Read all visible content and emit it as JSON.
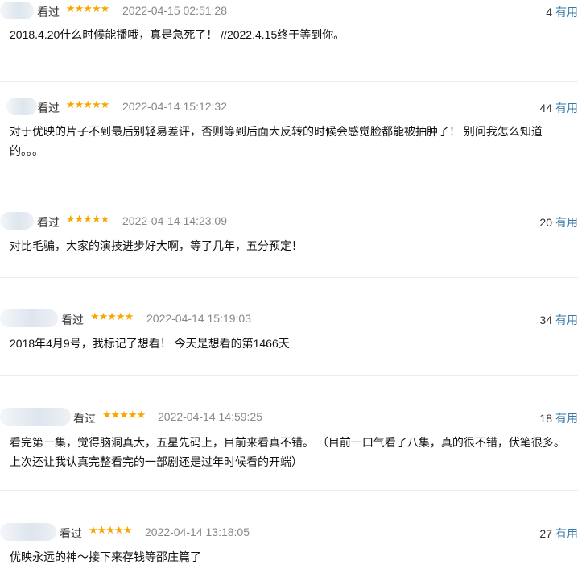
{
  "comments": [
    {
      "watched": "看过",
      "stars": "★★★★★",
      "time": "2022-04-15 02:51:28",
      "votes": "4",
      "helpful_label": "有用",
      "content": "2018.4.20什么时候能播哦，真是急死了！ //2022.4.15终于等到你。"
    },
    {
      "watched": "看过",
      "stars": "★★★★★",
      "time": "2022-04-14 15:12:32",
      "votes": "44",
      "helpful_label": "有用",
      "content": "对于优映的片子不到最后别轻易差评，否则等到后面大反转的时候会感觉脸都能被抽肿了！ 别问我怎么知道的。。。"
    },
    {
      "watched": "看过",
      "stars": "★★★★★",
      "time": "2022-04-14 14:23:09",
      "votes": "20",
      "helpful_label": "有用",
      "content": "对比毛骗，大家的演技进步好大啊，等了几年，五分预定！"
    },
    {
      "watched": "看过",
      "stars": "★★★★★",
      "time": "2022-04-14 15:19:03",
      "votes": "34",
      "helpful_label": "有用",
      "content": "2018年4月9号，我标记了想看！ 今天是想看的第1466天"
    },
    {
      "watched": "看过",
      "stars": "★★★★★",
      "time": "2022-04-14 14:59:25",
      "votes": "18",
      "helpful_label": "有用",
      "content": "看完第一集，觉得脑洞真大，五星先码上，目前来看真不错。 （目前一口气看了八集，真的很不错，伏笔很多。上次还让我认真完整看完的一部剧还是过年时候看的开端）"
    },
    {
      "watched": "看过",
      "stars": "★★★★★",
      "time": "2022-04-14 13:18:05",
      "votes": "27",
      "helpful_label": "有用",
      "content": "优映永远的神～接下来存钱等邵庄篇了"
    }
  ]
}
